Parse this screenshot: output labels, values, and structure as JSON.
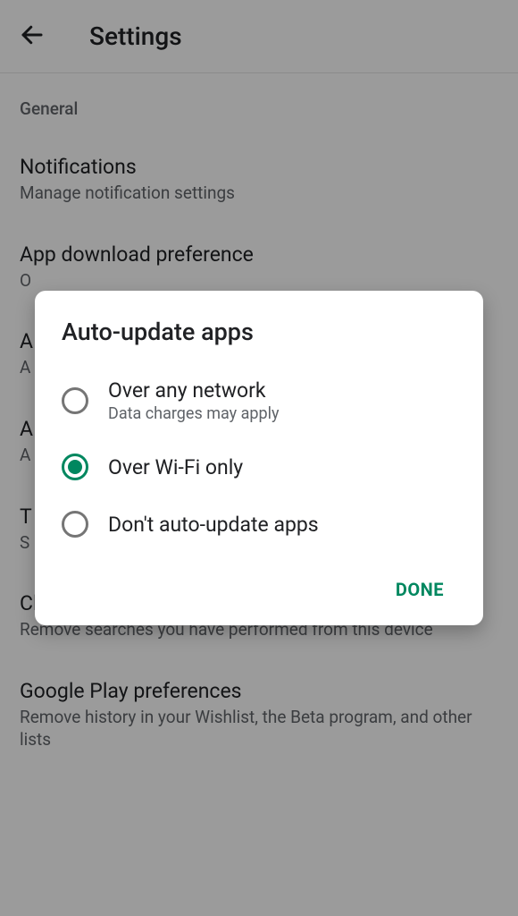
{
  "header": {
    "title": "Settings"
  },
  "settings": {
    "section_label": "General",
    "items": [
      {
        "title": "Notifications",
        "desc": "Manage notification settings"
      },
      {
        "title": "App download preference",
        "desc": "O"
      },
      {
        "title": "A",
        "desc": "A"
      },
      {
        "title": "A",
        "desc": "A"
      },
      {
        "title": "T",
        "desc": "S"
      },
      {
        "title": "Clear local search history",
        "desc": "Remove searches you have performed from this device"
      },
      {
        "title": "Google Play preferences",
        "desc": "Remove history in your Wishlist, the Beta program, and other lists"
      }
    ]
  },
  "dialog": {
    "title": "Auto-update apps",
    "options": [
      {
        "label": "Over any network",
        "sub": "Data charges may apply",
        "selected": false
      },
      {
        "label": "Over Wi-Fi only",
        "sub": "",
        "selected": true
      },
      {
        "label": "Don't auto-update apps",
        "sub": "",
        "selected": false
      }
    ],
    "done": "DONE"
  },
  "colors": {
    "accent": "#00875f"
  }
}
